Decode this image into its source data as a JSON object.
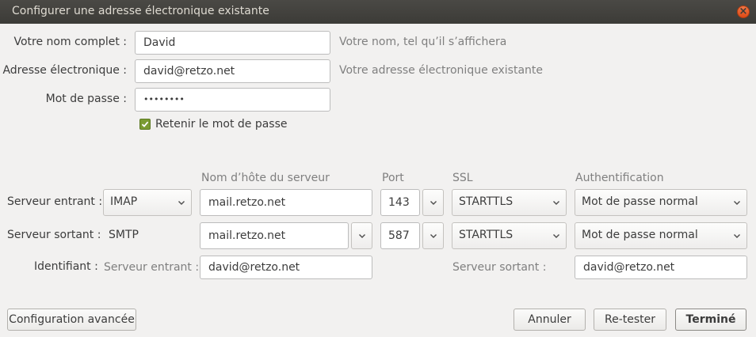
{
  "window": {
    "title": "Configurer une adresse électronique existante",
    "close_glyph": "×"
  },
  "form": {
    "name_label": "Votre nom complet :",
    "name_value": "David",
    "name_hint": "Votre nom, tel qu’il s’affichera",
    "email_label": "Adresse électronique :",
    "email_value": "david@retzo.net",
    "email_hint": "Votre adresse électronique existante",
    "password_label": "Mot de passe :",
    "password_value": "••••••••",
    "remember_label": "Retenir le mot de passe",
    "remember_checked": true
  },
  "servers": {
    "headers": {
      "hostname": "Nom d’hôte du serveur",
      "port": "Port",
      "ssl": "SSL",
      "auth": "Authentification"
    },
    "incoming": {
      "label": "Serveur entrant :",
      "protocol": "IMAP",
      "hostname": "mail.retzo.net",
      "port": "143",
      "ssl": "STARTTLS",
      "auth": "Mot de passe normal"
    },
    "outgoing": {
      "label": "Serveur sortant :",
      "protocol": "SMTP",
      "hostname": "mail.retzo.net",
      "port": "587",
      "ssl": "STARTTLS",
      "auth": "Mot de passe normal"
    },
    "identity": {
      "label": "Identifiant :",
      "incoming_label": "Serveur entrant :",
      "incoming_value": "david@retzo.net",
      "outgoing_label": "Serveur sortant :",
      "outgoing_value": "david@retzo.net"
    }
  },
  "buttons": {
    "advanced": "Configuration avancée",
    "cancel": "Annuler",
    "retest": "Re-tester",
    "done": "Terminé"
  },
  "icons": {
    "close": "close-icon",
    "dropdown": "chevron-down-icon",
    "check": "checkmark-icon"
  },
  "colors": {
    "titlebar": "#3c3b37",
    "close_button": "#df4a16",
    "checkbox": "#7a9b32",
    "background": "#f2f1f0"
  }
}
